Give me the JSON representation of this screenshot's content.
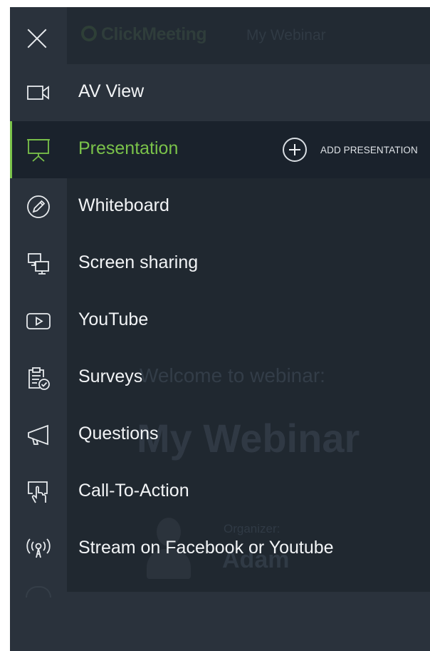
{
  "background": {
    "logo": "ClickMeeting",
    "tab": "My Webinar",
    "welcome": "Welcome to webinar:",
    "title": "My Webinar",
    "organizer_label": "Organizer:",
    "organizer_name": "Adam"
  },
  "menu": {
    "items": [
      {
        "label": "AV View",
        "icon": "video-camera-icon"
      },
      {
        "label": "Presentation",
        "icon": "presentation-board-icon",
        "active": true
      },
      {
        "label": "Whiteboard",
        "icon": "pencil-circle-icon"
      },
      {
        "label": "Screen sharing",
        "icon": "screen-sharing-icon"
      },
      {
        "label": "YouTube",
        "icon": "youtube-play-icon"
      },
      {
        "label": "Surveys",
        "icon": "clipboard-check-icon"
      },
      {
        "label": "Questions",
        "icon": "megaphone-icon"
      },
      {
        "label": "Call-To-Action",
        "icon": "hand-pointer-icon"
      },
      {
        "label": "Stream on Facebook or Youtube",
        "icon": "broadcast-icon"
      }
    ],
    "add_presentation": "ADD PRESENTATION"
  },
  "colors": {
    "accent": "#7ac24a",
    "menu_bg": "#2a323c",
    "active_bg": "#1a222c",
    "text": "#f2f4f6"
  }
}
